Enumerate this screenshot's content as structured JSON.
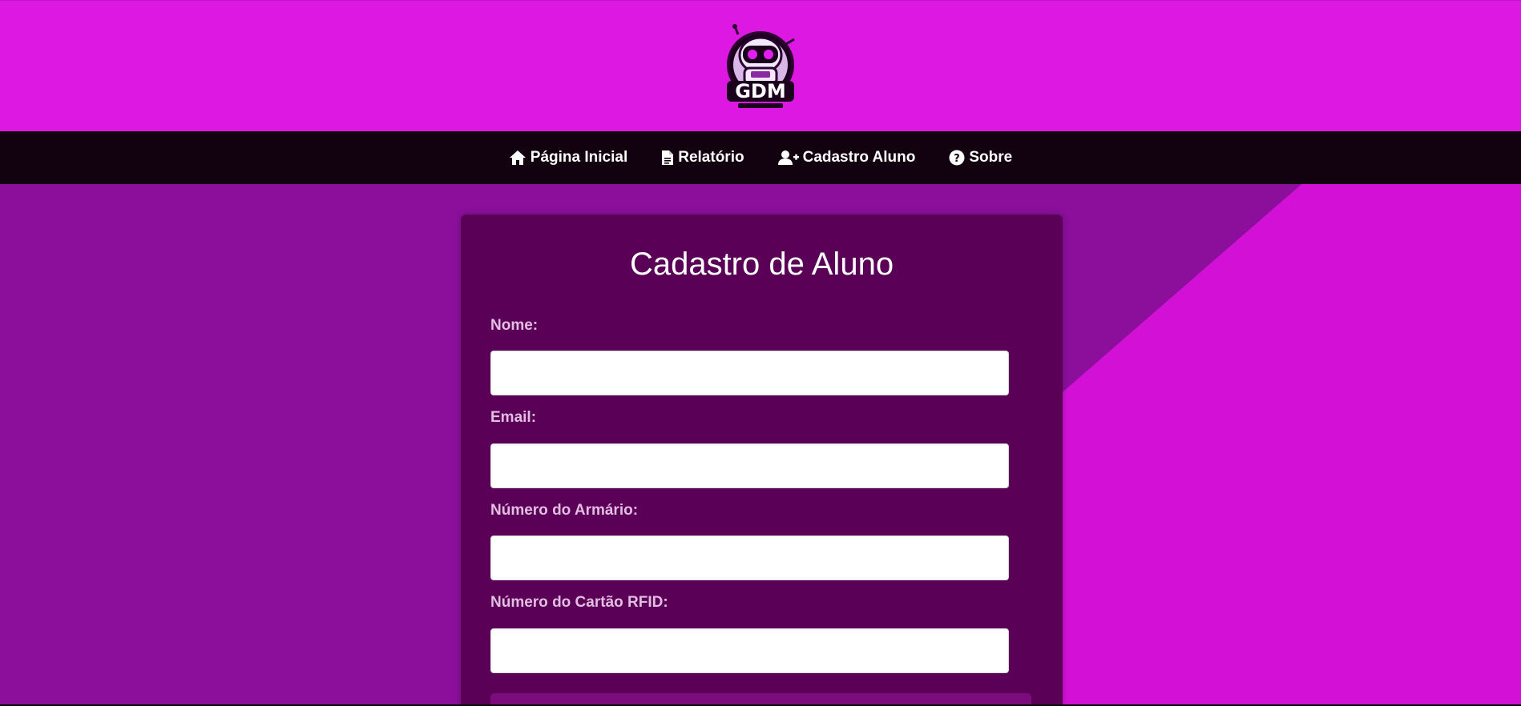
{
  "header": {
    "logo_alt": "GDM"
  },
  "nav": {
    "items": [
      {
        "label": "Página Inicial",
        "icon": "home-icon"
      },
      {
        "label": "Relatório",
        "icon": "document-icon"
      },
      {
        "label": "Cadastro Aluno",
        "icon": "user-plus-icon"
      },
      {
        "label": "Sobre",
        "icon": "question-circle-icon"
      }
    ]
  },
  "form": {
    "title": "Cadastro de Aluno",
    "fields": [
      {
        "label": "Nome:",
        "value": "",
        "placeholder": ""
      },
      {
        "label": "Email:",
        "value": "",
        "placeholder": ""
      },
      {
        "label": "Número do Armário:",
        "value": "",
        "placeholder": ""
      },
      {
        "label": "Número do Cartão RFID:",
        "value": "",
        "placeholder": ""
      }
    ]
  },
  "colors": {
    "header_bg": "#dc18e2",
    "nav_bg": "#12010f",
    "page_bg_left": "#8b0f9b",
    "page_bg_right": "#d311d6",
    "card_bg": "#5a0057",
    "label_color": "#e3bde2"
  }
}
